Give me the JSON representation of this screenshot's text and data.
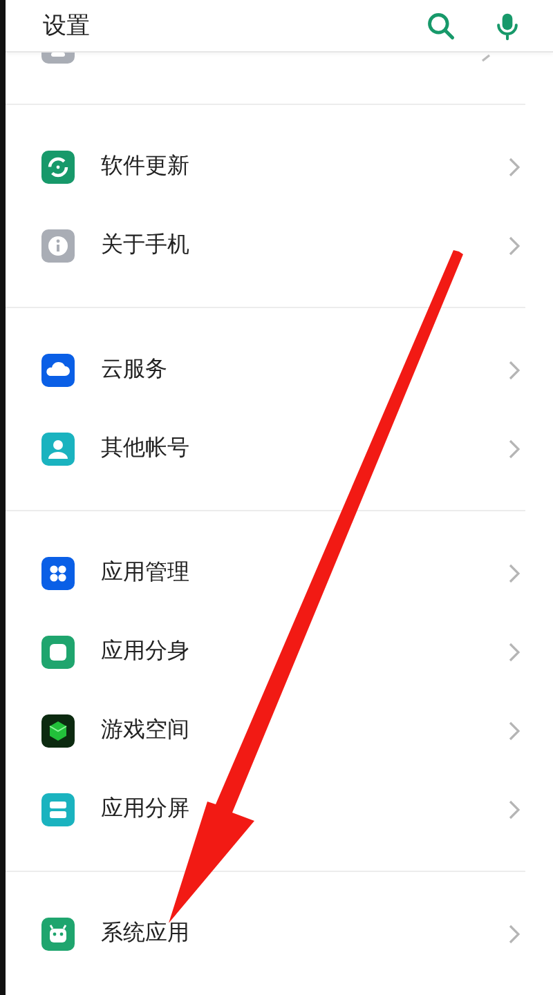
{
  "header": {
    "title": "设置"
  },
  "groups": [
    {
      "items": [
        {
          "label": "软件更新"
        },
        {
          "label": "关于手机"
        }
      ]
    },
    {
      "items": [
        {
          "label": "云服务"
        },
        {
          "label": "其他帐号"
        }
      ]
    },
    {
      "items": [
        {
          "label": "应用管理"
        },
        {
          "label": "应用分身"
        },
        {
          "label": "游戏空间"
        },
        {
          "label": "应用分屏"
        }
      ]
    },
    {
      "items": [
        {
          "label": "系统应用"
        }
      ]
    }
  ],
  "annotation": {
    "kind": "arrow"
  }
}
